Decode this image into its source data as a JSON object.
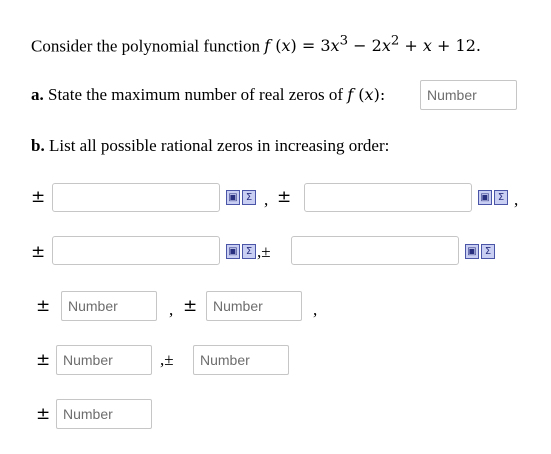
{
  "question": {
    "intro": "Consider the polynomial function",
    "func": "f",
    "var": "x",
    "equals": " = 3",
    "exp3": "3",
    "minus": " − 2",
    "exp2": "2",
    "plus_x": " + ",
    "tail": " + 12."
  },
  "part_a": {
    "label": "a.",
    "text": "State the maximum number of real zeros of",
    "colon": ":",
    "placeholder": "Number"
  },
  "part_b": {
    "label": "b.",
    "text": "List all possible rational zeros in increasing order:"
  },
  "symbols": {
    "plus_minus": "±",
    "comma": ",",
    "comma_pm": ",±"
  },
  "number_placeholder": "Number",
  "tool_icons": [
    "fraction-tool-icon",
    "sigma-tool-icon"
  ]
}
